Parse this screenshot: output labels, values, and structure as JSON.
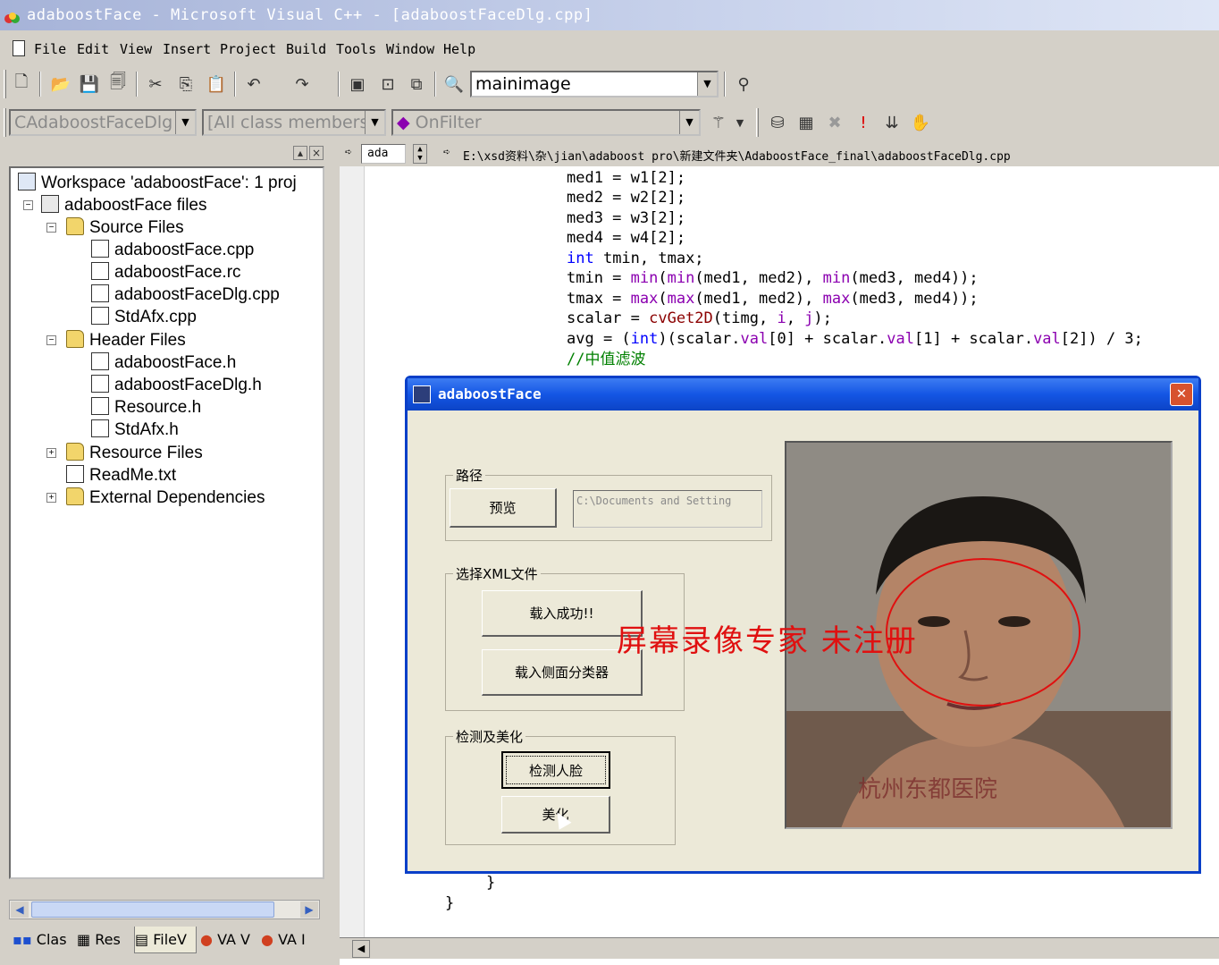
{
  "window": {
    "title": "adaboostFace - Microsoft Visual C++ - [adaboostFaceDlg.cpp]"
  },
  "menu": [
    "File",
    "Edit",
    "View",
    "Insert",
    "Project",
    "Build",
    "Tools",
    "Window",
    "Help"
  ],
  "toolbar": {
    "find_combo_value": "mainimage",
    "class_combo_value": "CAdaboostFaceDlg",
    "filter_combo_value": "[All class members]",
    "members_combo_value": "OnFilter"
  },
  "workspace": {
    "tree": [
      {
        "label": "Workspace 'adaboostFace': 1 proj",
        "icon": "workspace-icon"
      },
      {
        "label": "adaboostFace files",
        "icon": "project-icon"
      },
      {
        "label": "Source Files",
        "icon": "folder-icon"
      },
      {
        "label": "adaboostFace.cpp",
        "icon": "cpp-file-icon"
      },
      {
        "label": "adaboostFace.rc",
        "icon": "rc-file-icon"
      },
      {
        "label": "adaboostFaceDlg.cpp",
        "icon": "cpp-file-icon"
      },
      {
        "label": "StdAfx.cpp",
        "icon": "cpp-file-icon"
      },
      {
        "label": "Header Files",
        "icon": "folder-icon"
      },
      {
        "label": "adaboostFace.h",
        "icon": "header-file-icon"
      },
      {
        "label": "adaboostFaceDlg.h",
        "icon": "header-file-icon"
      },
      {
        "label": "Resource.h",
        "icon": "header-file-icon"
      },
      {
        "label": "StdAfx.h",
        "icon": "header-file-icon"
      },
      {
        "label": "Resource Files",
        "icon": "folder-icon"
      },
      {
        "label": "ReadMe.txt",
        "icon": "text-file-icon"
      },
      {
        "label": "External Dependencies",
        "icon": "folder-icon"
      }
    ],
    "tabs": [
      "Clas",
      "Res",
      "FileV",
      "VA V",
      "VA I"
    ]
  },
  "editor": {
    "small_combo": "ada",
    "path": "E:\\xsd资料\\杂\\jian\\adaboost pro\\新建文件夹\\AdaboostFace_final\\adaboostFaceDlg.cpp",
    "code": {
      "l1": "med1 = w1[2];",
      "l2": "med2 = w2[2];",
      "l3": "med3 = w3[2];",
      "l4": "med4 = w4[2];",
      "l5_kw": "int",
      "l5_rest": " tmin, tmax;",
      "l6a": "tmin = ",
      "l6_min1": "min",
      "l6b": "(",
      "l6_min2": "min",
      "l6c": "(med1, med2), ",
      "l6_min3": "min",
      "l6d": "(med3, med4));",
      "l7a": "tmax = ",
      "l7_max1": "max",
      "l7b": "(",
      "l7_max2": "max",
      "l7c": "(med1, med2), ",
      "l7_max3": "max",
      "l7d": "(med3, med4));",
      "l8a": "scalar = ",
      "l8_fn": "cvGet2D",
      "l8b": "(timg, ",
      "l8_i": "i",
      "l8c": ", ",
      "l8_j": "j",
      "l8d": ");",
      "l9a": "avg = (",
      "l9_kw": "int",
      "l9b": ")(scalar.",
      "l9_v1": "val",
      "l9c": "[0] + scalar.",
      "l9_v2": "val",
      "l9d": "[1] + scalar.",
      "l9_v3": "val",
      "l9e": "[2]) / 3;",
      "l10_comment": "//中值滤波",
      "l11": "}",
      "l12": "}"
    }
  },
  "dialog": {
    "title": "adaboostFace",
    "path_group_label": "路径",
    "preview_button": "预览",
    "path_value": "C:\\Documents and Setting",
    "xml_group_label": "选择XML文件",
    "load_success_button": "载入成功!!",
    "load_side_button": "载入侧面分类器",
    "detect_group_label": "检测及美化",
    "detect_button": "检测人脸",
    "beautify_button": "美化",
    "watermark": "屏幕录像专家  未注册",
    "photo_caption": "杭州东都医院"
  },
  "colors": {
    "dialog_border": "#0a3fc8",
    "keyword": "#0000ff",
    "function": "#8b00b0",
    "comment": "#008000",
    "watermark": "#e01010"
  }
}
